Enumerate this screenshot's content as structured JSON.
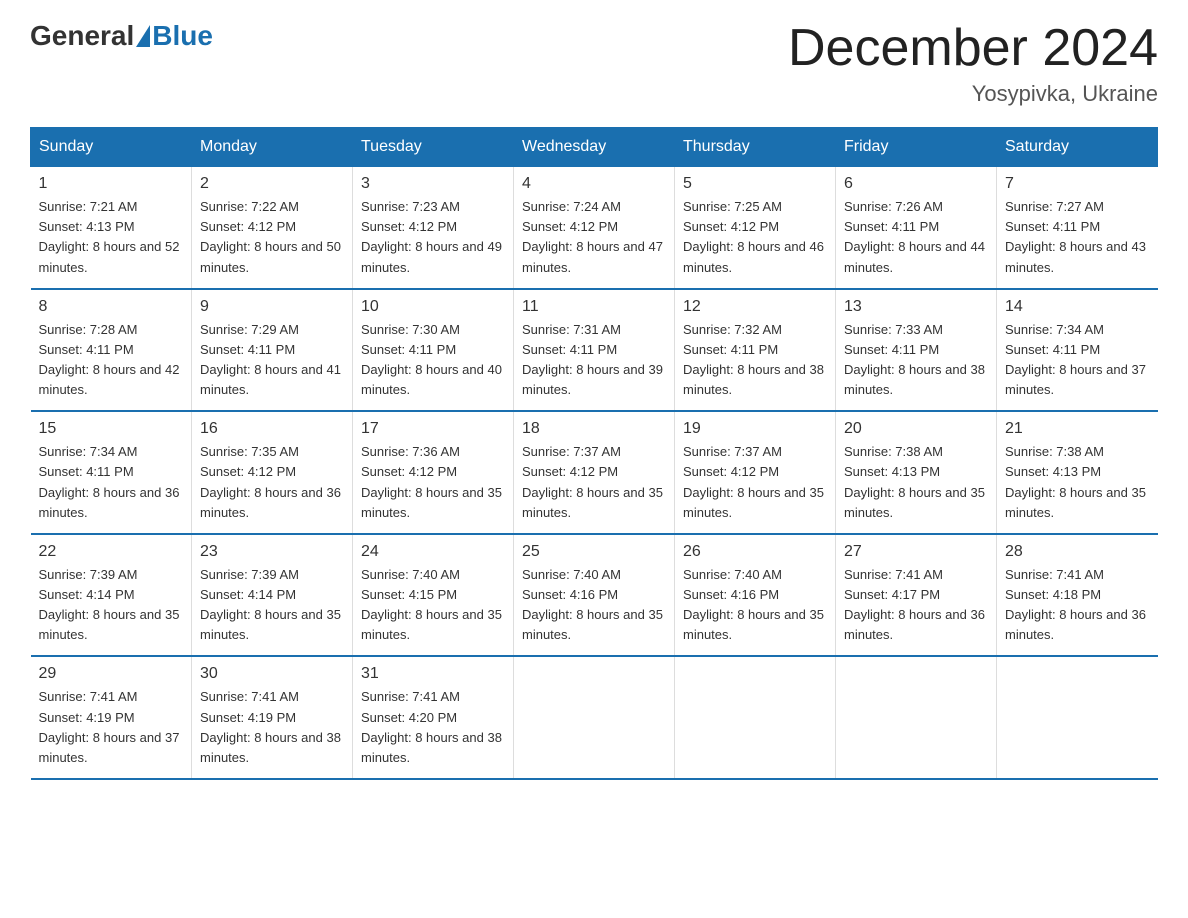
{
  "logo": {
    "text_general": "General",
    "text_blue": "Blue"
  },
  "header": {
    "month": "December 2024",
    "location": "Yosypivka, Ukraine"
  },
  "weekdays": [
    "Sunday",
    "Monday",
    "Tuesday",
    "Wednesday",
    "Thursday",
    "Friday",
    "Saturday"
  ],
  "weeks": [
    [
      {
        "day": "1",
        "sunrise": "7:21 AM",
        "sunset": "4:13 PM",
        "daylight": "8 hours and 52 minutes."
      },
      {
        "day": "2",
        "sunrise": "7:22 AM",
        "sunset": "4:12 PM",
        "daylight": "8 hours and 50 minutes."
      },
      {
        "day": "3",
        "sunrise": "7:23 AM",
        "sunset": "4:12 PM",
        "daylight": "8 hours and 49 minutes."
      },
      {
        "day": "4",
        "sunrise": "7:24 AM",
        "sunset": "4:12 PM",
        "daylight": "8 hours and 47 minutes."
      },
      {
        "day": "5",
        "sunrise": "7:25 AM",
        "sunset": "4:12 PM",
        "daylight": "8 hours and 46 minutes."
      },
      {
        "day": "6",
        "sunrise": "7:26 AM",
        "sunset": "4:11 PM",
        "daylight": "8 hours and 44 minutes."
      },
      {
        "day": "7",
        "sunrise": "7:27 AM",
        "sunset": "4:11 PM",
        "daylight": "8 hours and 43 minutes."
      }
    ],
    [
      {
        "day": "8",
        "sunrise": "7:28 AM",
        "sunset": "4:11 PM",
        "daylight": "8 hours and 42 minutes."
      },
      {
        "day": "9",
        "sunrise": "7:29 AM",
        "sunset": "4:11 PM",
        "daylight": "8 hours and 41 minutes."
      },
      {
        "day": "10",
        "sunrise": "7:30 AM",
        "sunset": "4:11 PM",
        "daylight": "8 hours and 40 minutes."
      },
      {
        "day": "11",
        "sunrise": "7:31 AM",
        "sunset": "4:11 PM",
        "daylight": "8 hours and 39 minutes."
      },
      {
        "day": "12",
        "sunrise": "7:32 AM",
        "sunset": "4:11 PM",
        "daylight": "8 hours and 38 minutes."
      },
      {
        "day": "13",
        "sunrise": "7:33 AM",
        "sunset": "4:11 PM",
        "daylight": "8 hours and 38 minutes."
      },
      {
        "day": "14",
        "sunrise": "7:34 AM",
        "sunset": "4:11 PM",
        "daylight": "8 hours and 37 minutes."
      }
    ],
    [
      {
        "day": "15",
        "sunrise": "7:34 AM",
        "sunset": "4:11 PM",
        "daylight": "8 hours and 36 minutes."
      },
      {
        "day": "16",
        "sunrise": "7:35 AM",
        "sunset": "4:12 PM",
        "daylight": "8 hours and 36 minutes."
      },
      {
        "day": "17",
        "sunrise": "7:36 AM",
        "sunset": "4:12 PM",
        "daylight": "8 hours and 35 minutes."
      },
      {
        "day": "18",
        "sunrise": "7:37 AM",
        "sunset": "4:12 PM",
        "daylight": "8 hours and 35 minutes."
      },
      {
        "day": "19",
        "sunrise": "7:37 AM",
        "sunset": "4:12 PM",
        "daylight": "8 hours and 35 minutes."
      },
      {
        "day": "20",
        "sunrise": "7:38 AM",
        "sunset": "4:13 PM",
        "daylight": "8 hours and 35 minutes."
      },
      {
        "day": "21",
        "sunrise": "7:38 AM",
        "sunset": "4:13 PM",
        "daylight": "8 hours and 35 minutes."
      }
    ],
    [
      {
        "day": "22",
        "sunrise": "7:39 AM",
        "sunset": "4:14 PM",
        "daylight": "8 hours and 35 minutes."
      },
      {
        "day": "23",
        "sunrise": "7:39 AM",
        "sunset": "4:14 PM",
        "daylight": "8 hours and 35 minutes."
      },
      {
        "day": "24",
        "sunrise": "7:40 AM",
        "sunset": "4:15 PM",
        "daylight": "8 hours and 35 minutes."
      },
      {
        "day": "25",
        "sunrise": "7:40 AM",
        "sunset": "4:16 PM",
        "daylight": "8 hours and 35 minutes."
      },
      {
        "day": "26",
        "sunrise": "7:40 AM",
        "sunset": "4:16 PM",
        "daylight": "8 hours and 35 minutes."
      },
      {
        "day": "27",
        "sunrise": "7:41 AM",
        "sunset": "4:17 PM",
        "daylight": "8 hours and 36 minutes."
      },
      {
        "day": "28",
        "sunrise": "7:41 AM",
        "sunset": "4:18 PM",
        "daylight": "8 hours and 36 minutes."
      }
    ],
    [
      {
        "day": "29",
        "sunrise": "7:41 AM",
        "sunset": "4:19 PM",
        "daylight": "8 hours and 37 minutes."
      },
      {
        "day": "30",
        "sunrise": "7:41 AM",
        "sunset": "4:19 PM",
        "daylight": "8 hours and 38 minutes."
      },
      {
        "day": "31",
        "sunrise": "7:41 AM",
        "sunset": "4:20 PM",
        "daylight": "8 hours and 38 minutes."
      },
      null,
      null,
      null,
      null
    ]
  ]
}
